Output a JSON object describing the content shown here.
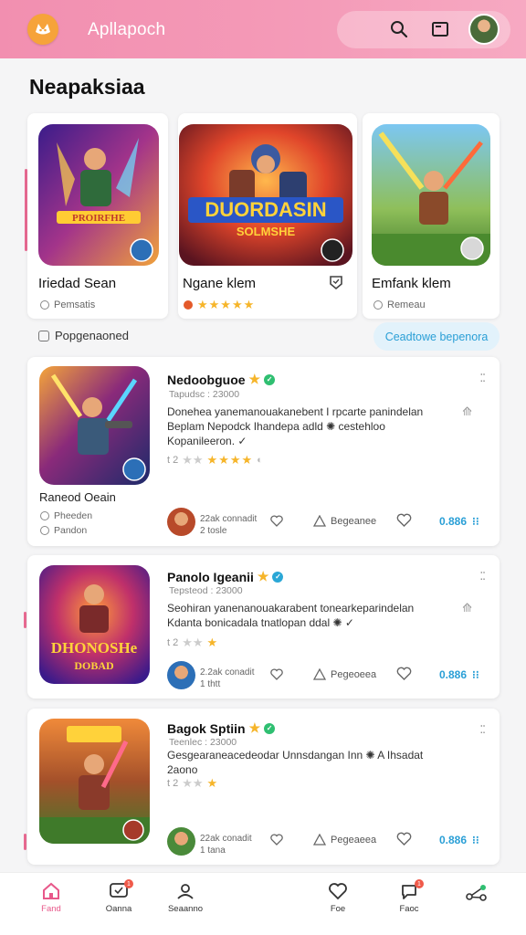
{
  "header": {
    "app_title": "Apllapoch"
  },
  "section_title": "Neapaksiaa",
  "featured": [
    {
      "name": "Iriedad Sean",
      "sub": "Pemsatis"
    },
    {
      "name": "Ngane klem",
      "sub_stars": "★★★★★"
    },
    {
      "name": "Emfank klem",
      "sub": "Remeau"
    }
  ],
  "filter": {
    "checkbox_label": "Popgenaoned",
    "button_label": "Ceadtowe bepenora"
  },
  "list": [
    {
      "title": "Nedoobguoe",
      "subtitle": "Tapudsc : 23000",
      "desc": "Donehea yanemanouakanebent I rpcarte panindelan Beplam Nepodck Ihandepa adld ✺ cestehloo Kopanileeron. ✓",
      "rating_prefix": "t 2",
      "left_title": "Raneod Oeain",
      "left_lines": [
        "Pheeden",
        "Pandon"
      ],
      "meta1": "22ak connadit",
      "meta2": "2 tosle",
      "action_label": "Begeanee",
      "count": "0.886"
    },
    {
      "title": "Panolo Igeanii",
      "subtitle": "Tepsteod : 23000",
      "desc": "Seohiran yanenanouakarabent tonearkeparindelan Kdanta bonicadala tnatlopan ddal ✺ ✓",
      "rating_prefix": "t 2",
      "meta1": "2.2ak conadit",
      "meta2": "1 thtt",
      "action_label": "Pegeoeea",
      "count": "0.886"
    },
    {
      "title": "Bagok Sptiin",
      "subtitle": "Teenlec : 23000",
      "desc": "Gesgearaneacedeodar Unnsdangan Inn ✺ A Ihsadat 2aono",
      "rating_prefix": "t 2",
      "meta1": "22ak conadit",
      "meta2": "1 tana",
      "action_label": "Pegeaeea",
      "count": "0.886"
    }
  ],
  "bottom_nav": [
    {
      "label": "Fand",
      "icon": "home-icon"
    },
    {
      "label": "Oanna",
      "icon": "chat-icon",
      "badge": "1"
    },
    {
      "label": "Seaanno",
      "icon": "profile-icon"
    },
    {
      "label": "Foe",
      "icon": "heart-icon"
    },
    {
      "label": "Faoc",
      "icon": "comment-icon",
      "badge": "1"
    },
    {
      "label": "",
      "icon": "share-network-icon"
    }
  ],
  "colors": {
    "header": "#f49bb8",
    "accent_blue": "#2a9fd6",
    "star": "#f6b52a",
    "verified": "#2fbf71"
  }
}
